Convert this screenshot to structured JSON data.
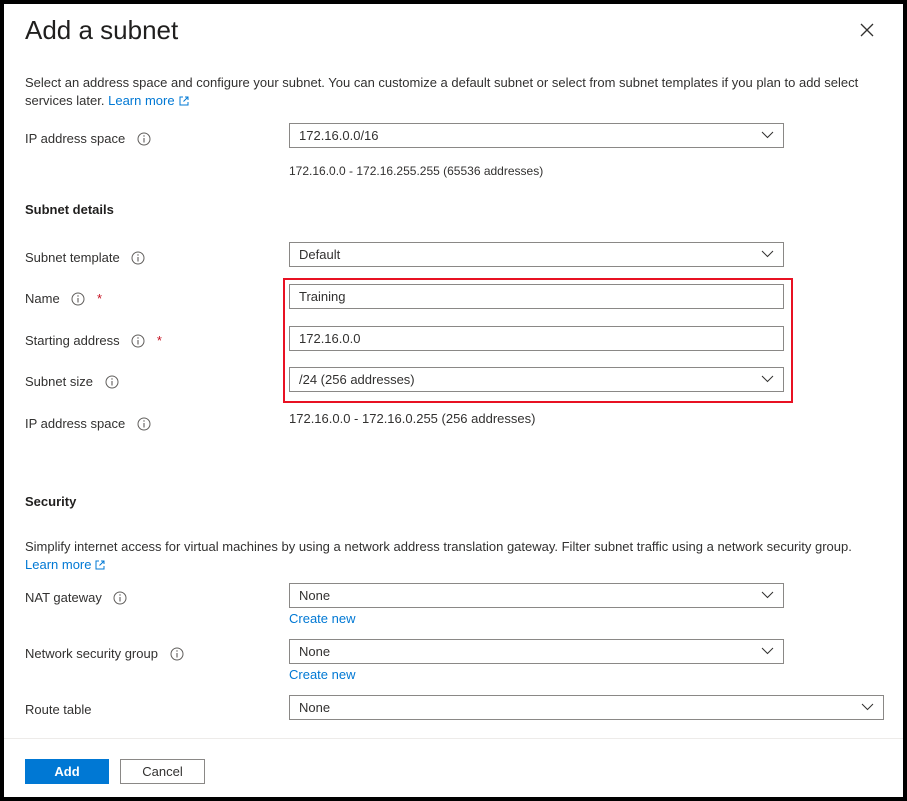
{
  "dialog": {
    "title": "Add a subnet",
    "description": "Select an address space and configure your subnet. You can customize a default subnet or select from subnet templates if you plan to add select services later.",
    "learn_more": "Learn more"
  },
  "address_space": {
    "label": "IP address space",
    "value": "172.16.0.0/16",
    "range": "172.16.0.0 - 172.16.255.255 (65536 addresses)"
  },
  "subnet_details": {
    "heading": "Subnet details",
    "template_label": "Subnet template",
    "template_value": "Default",
    "name_label": "Name",
    "name_value": "Training",
    "start_label": "Starting address",
    "start_value": "172.16.0.0",
    "size_label": "Subnet size",
    "size_value": "/24 (256 addresses)",
    "ip_space_label": "IP address space",
    "ip_space_value": "172.16.0.0 - 172.16.0.255 (256 addresses)",
    "required_mark": "*"
  },
  "security": {
    "heading": "Security",
    "description": "Simplify internet access for virtual machines by using a network address translation gateway. Filter subnet traffic using a network security group.",
    "learn_more": "Learn more",
    "nat_label": "NAT gateway",
    "nat_value": "None",
    "nat_create": "Create new",
    "nsg_label": "Network security group",
    "nsg_value": "None",
    "nsg_create": "Create new",
    "route_label": "Route table",
    "route_value": "None"
  },
  "footer": {
    "add_label": "Add",
    "cancel_label": "Cancel"
  },
  "colors": {
    "accent": "#0078d4",
    "highlight": "#e81123",
    "required": "#c50f1f"
  },
  "icons": [
    "close-icon",
    "info-icon",
    "external-link-icon",
    "chevron-down-icon"
  ]
}
